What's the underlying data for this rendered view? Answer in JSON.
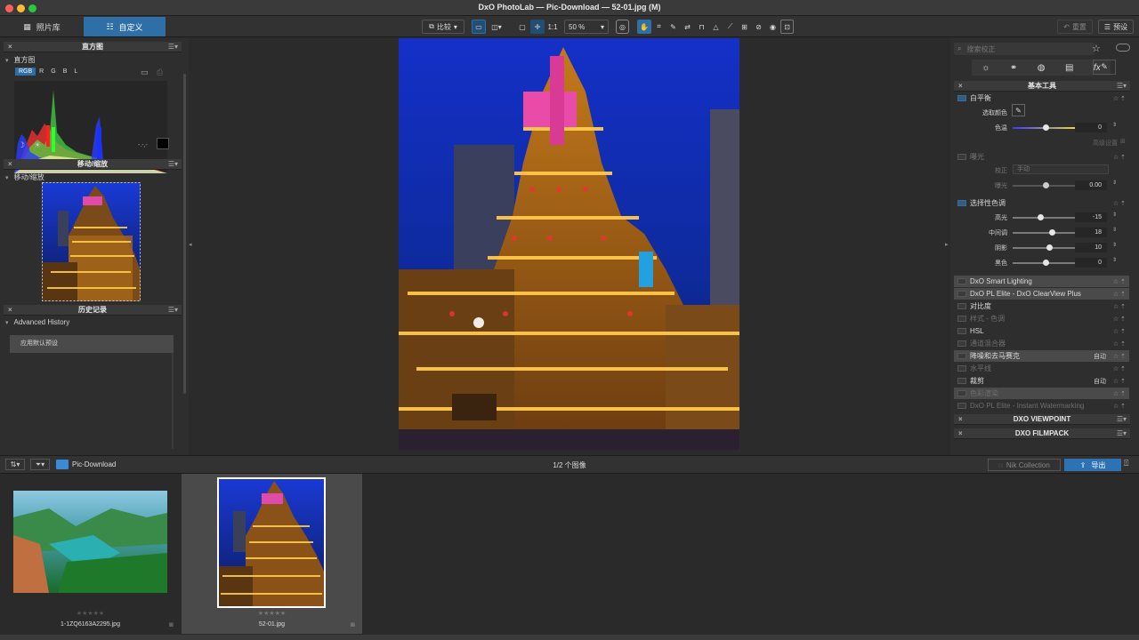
{
  "window": {
    "title": "DxO PhotoLab — Pic-Download — 52-01.jpg (M)"
  },
  "modes": {
    "library": "照片库",
    "customize": "自定义"
  },
  "toolbar": {
    "compare": "比较",
    "split": "",
    "one_to_one": "1:1",
    "zoom": "50 %",
    "reset": "重置",
    "presets": "预设"
  },
  "histogram": {
    "title": "直方图",
    "sub": "直方图",
    "channels": [
      "RGB",
      "R",
      "G",
      "B",
      "L"
    ],
    "clip_values": "-.-,-"
  },
  "move_zoom": {
    "title": "移动/缩放",
    "sub": "移动/缩放"
  },
  "history": {
    "title": "历史记录",
    "sub": "Advanced History",
    "items": [
      "应用默认预设"
    ]
  },
  "search": {
    "placeholder": "搜索校正"
  },
  "essential": {
    "title": "基本工具",
    "white_balance": {
      "label": "白平衡",
      "picker_label": "选取颜色",
      "temp_label": "色温",
      "temp_value": "0",
      "advanced": "高级设置"
    },
    "exposure": {
      "label": "曝光",
      "mode_label": "校正",
      "mode_value": "手动",
      "exp_label": "曝光",
      "exp_value": "0.00"
    },
    "tone": {
      "label": "选择性色调",
      "rows": [
        {
          "label": "高光",
          "value": "-15",
          "pos": 0.42
        },
        {
          "label": "中间调",
          "value": "18",
          "pos": 0.59
        },
        {
          "label": "阴影",
          "value": "10",
          "pos": 0.55
        },
        {
          "label": "黑色",
          "value": "0",
          "pos": 0.5
        }
      ]
    },
    "temp_pos": 0.5,
    "exp_pos": 0.5,
    "list": [
      {
        "label": "DxO Smart Lighting",
        "state": "",
        "hl": true,
        "dim": false
      },
      {
        "label": "DxO PL Elite - DxO ClearView Plus",
        "state": "",
        "hl": true,
        "dim": false
      },
      {
        "label": "对比度",
        "state": "",
        "hl": false,
        "dim": false
      },
      {
        "label": "样式 - 色调",
        "state": "",
        "hl": false,
        "dim": true
      },
      {
        "label": "HSL",
        "state": "",
        "hl": false,
        "dim": false
      },
      {
        "label": "通道混合器",
        "state": "",
        "hl": false,
        "dim": true
      },
      {
        "label": "降噪和去马赛克",
        "state": "自动",
        "hl": true,
        "dim": false
      },
      {
        "label": "水平线",
        "state": "",
        "hl": false,
        "dim": true
      },
      {
        "label": "裁剪",
        "state": "自动",
        "hl": false,
        "dim": false
      },
      {
        "label": "色彩渲染",
        "state": "",
        "hl": true,
        "dim": true
      },
      {
        "label": "DxO PL Elite - Instant Watermarking",
        "state": "",
        "hl": false,
        "dim": true
      }
    ]
  },
  "viewpoint": {
    "title": "DXO VIEWPOINT"
  },
  "filmpack": {
    "title": "DXO FILMPACK"
  },
  "bottom": {
    "folder": "Pic-Download",
    "count": "1/2 个图像",
    "nik": "Nik Collection",
    "export": "导出"
  },
  "thumbs": [
    {
      "name": "1-1ZQ6163A2295.jpg",
      "stars": "★★★★★"
    },
    {
      "name": "52-01.jpg",
      "stars": "★★★★★"
    }
  ],
  "colors": {
    "accent": "#2e6fa8",
    "export": "#2f72b4"
  }
}
